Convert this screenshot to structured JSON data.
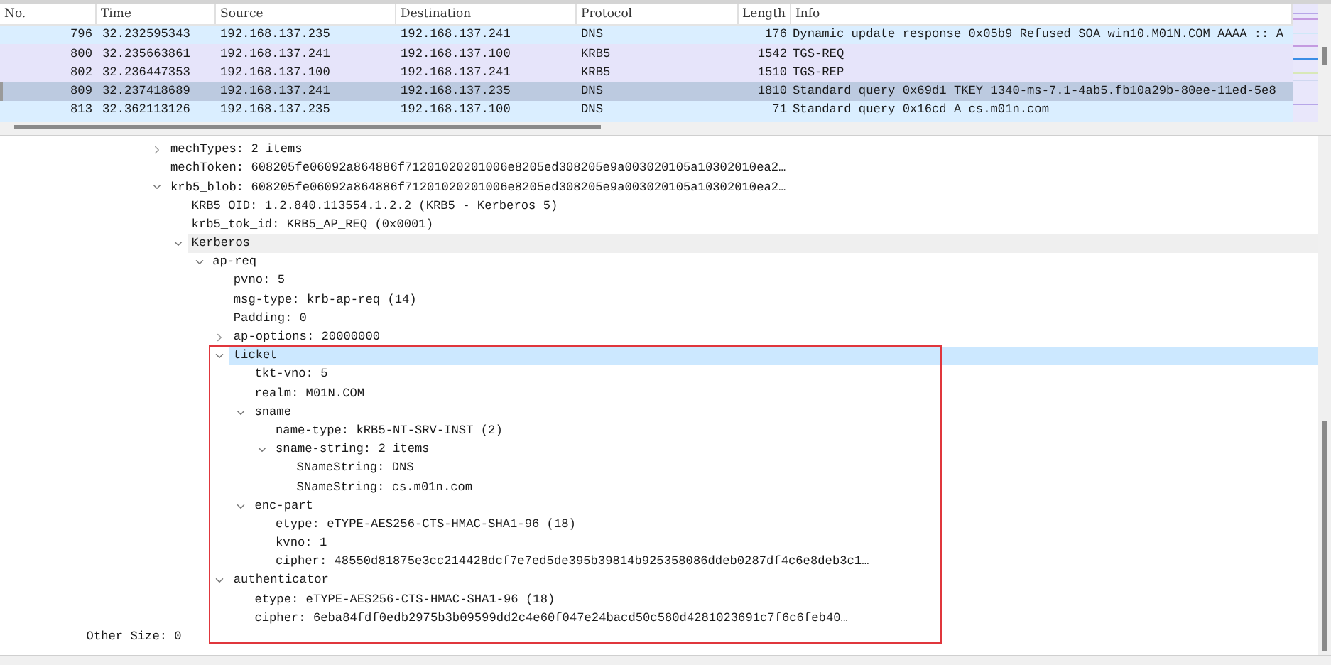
{
  "packet_list": {
    "columns": [
      "No.",
      "Time",
      "Source",
      "Destination",
      "Protocol",
      "Length",
      "Info"
    ],
    "rows": [
      {
        "no": "796",
        "time": "32.232595343",
        "source": "192.168.137.235",
        "destination": "192.168.137.241",
        "protocol": "DNS",
        "length": "176",
        "info": "Dynamic update response 0x05b9 Refused SOA win10.M01N.COM AAAA :: A",
        "color": "#daeeff",
        "selected": false
      },
      {
        "no": "800",
        "time": "32.235663861",
        "source": "192.168.137.241",
        "destination": "192.168.137.100",
        "protocol": "KRB5",
        "length": "1542",
        "info": "TGS-REQ",
        "color": "#e6e4fa",
        "selected": false
      },
      {
        "no": "802",
        "time": "32.236447353",
        "source": "192.168.137.100",
        "destination": "192.168.137.241",
        "protocol": "KRB5",
        "length": "1510",
        "info": "TGS-REP",
        "color": "#e6e4fa",
        "selected": false
      },
      {
        "no": "809",
        "time": "32.237418689",
        "source": "192.168.137.241",
        "destination": "192.168.137.235",
        "protocol": "DNS",
        "length": "1810",
        "info": "Standard query 0x69d1 TKEY 1340-ms-7.1-4ab5.fb10a29b-80ee-11ed-5e8",
        "color": "#daeeff",
        "selected": true
      },
      {
        "no": "813",
        "time": "32.362113126",
        "source": "192.168.137.235",
        "destination": "192.168.137.100",
        "protocol": "DNS",
        "length": "71",
        "info": "Standard query 0x16cd A cs.m01n.com",
        "color": "#daeeff",
        "selected": false
      }
    ]
  },
  "tree": [
    {
      "label": "mechTypes: 2 items",
      "expanded": false,
      "selected": false,
      "highlighted": false
    },
    {
      "label": "mechToken: 608205fe06092a864886f71201020201006e8205ed308205e9a003020105a10302010ea2…",
      "selected": false,
      "highlighted": false
    },
    {
      "label": "krb5_blob: 608205fe06092a864886f71201020201006e8205ed308205e9a003020105a10302010ea2…",
      "expanded": true,
      "selected": false,
      "highlighted": false,
      "children": [
        {
          "label": "KRB5 OID: 1.2.840.113554.1.2.2 (KRB5 - Kerberos 5)",
          "selected": false,
          "highlighted": false
        },
        {
          "label": "krb5_tok_id: KRB5_AP_REQ (0x0001)",
          "selected": false,
          "highlighted": false
        },
        {
          "label": "Kerberos",
          "expanded": true,
          "selected": false,
          "highlighted": true,
          "children": [
            {
              "label": "ap-req",
              "expanded": true,
              "selected": false,
              "highlighted": false,
              "children": [
                {
                  "label": "pvno: 5",
                  "selected": false,
                  "highlighted": false
                },
                {
                  "label": "msg-type: krb-ap-req (14)",
                  "selected": false,
                  "highlighted": false
                },
                {
                  "label": "Padding: 0",
                  "selected": false,
                  "highlighted": false
                },
                {
                  "label": "ap-options: 20000000",
                  "expanded": false,
                  "selected": false,
                  "highlighted": false
                },
                {
                  "label": "ticket",
                  "expanded": true,
                  "selected": true,
                  "highlighted": false,
                  "boxed": true,
                  "children": [
                    {
                      "label": "tkt-vno: 5",
                      "selected": false,
                      "highlighted": false
                    },
                    {
                      "label": "realm: M01N.COM",
                      "selected": false,
                      "highlighted": false
                    },
                    {
                      "label": "sname",
                      "expanded": true,
                      "selected": false,
                      "highlighted": false,
                      "children": [
                        {
                          "label": "name-type: kRB5-NT-SRV-INST (2)",
                          "selected": false,
                          "highlighted": false
                        },
                        {
                          "label": "sname-string: 2 items",
                          "expanded": true,
                          "selected": false,
                          "highlighted": false,
                          "children": [
                            {
                              "label": "SNameString: DNS",
                              "selected": false,
                              "highlighted": false
                            },
                            {
                              "label": "SNameString: cs.m01n.com",
                              "selected": false,
                              "highlighted": false
                            }
                          ]
                        }
                      ]
                    },
                    {
                      "label": "enc-part",
                      "expanded": true,
                      "selected": false,
                      "highlighted": false,
                      "children": [
                        {
                          "label": "etype: eTYPE-AES256-CTS-HMAC-SHA1-96 (18)",
                          "selected": false,
                          "highlighted": false
                        },
                        {
                          "label": "kvno: 1",
                          "selected": false,
                          "highlighted": false
                        },
                        {
                          "label": "cipher: 48550d81875e3cc214428dcf7e7ed5de395b39814b925358086ddeb0287df4c6e8deb3c1…",
                          "selected": false,
                          "highlighted": false
                        }
                      ]
                    }
                  ]
                },
                {
                  "label": "authenticator",
                  "expanded": true,
                  "selected": false,
                  "highlighted": false,
                  "boxed": true,
                  "children": [
                    {
                      "label": "etype: eTYPE-AES256-CTS-HMAC-SHA1-96 (18)",
                      "selected": false,
                      "highlighted": false
                    },
                    {
                      "label": "cipher: 6eba84fdf0edb2975b3b09599dd2c4e60f047e24bacd50c580d4281023691c7f6c6feb40…",
                      "selected": false,
                      "highlighted": false
                    }
                  ]
                }
              ]
            }
          ]
        }
      ]
    }
  ],
  "trailing_items": [
    {
      "label": "Other Size: 0",
      "selected": false,
      "highlighted": false
    }
  ]
}
